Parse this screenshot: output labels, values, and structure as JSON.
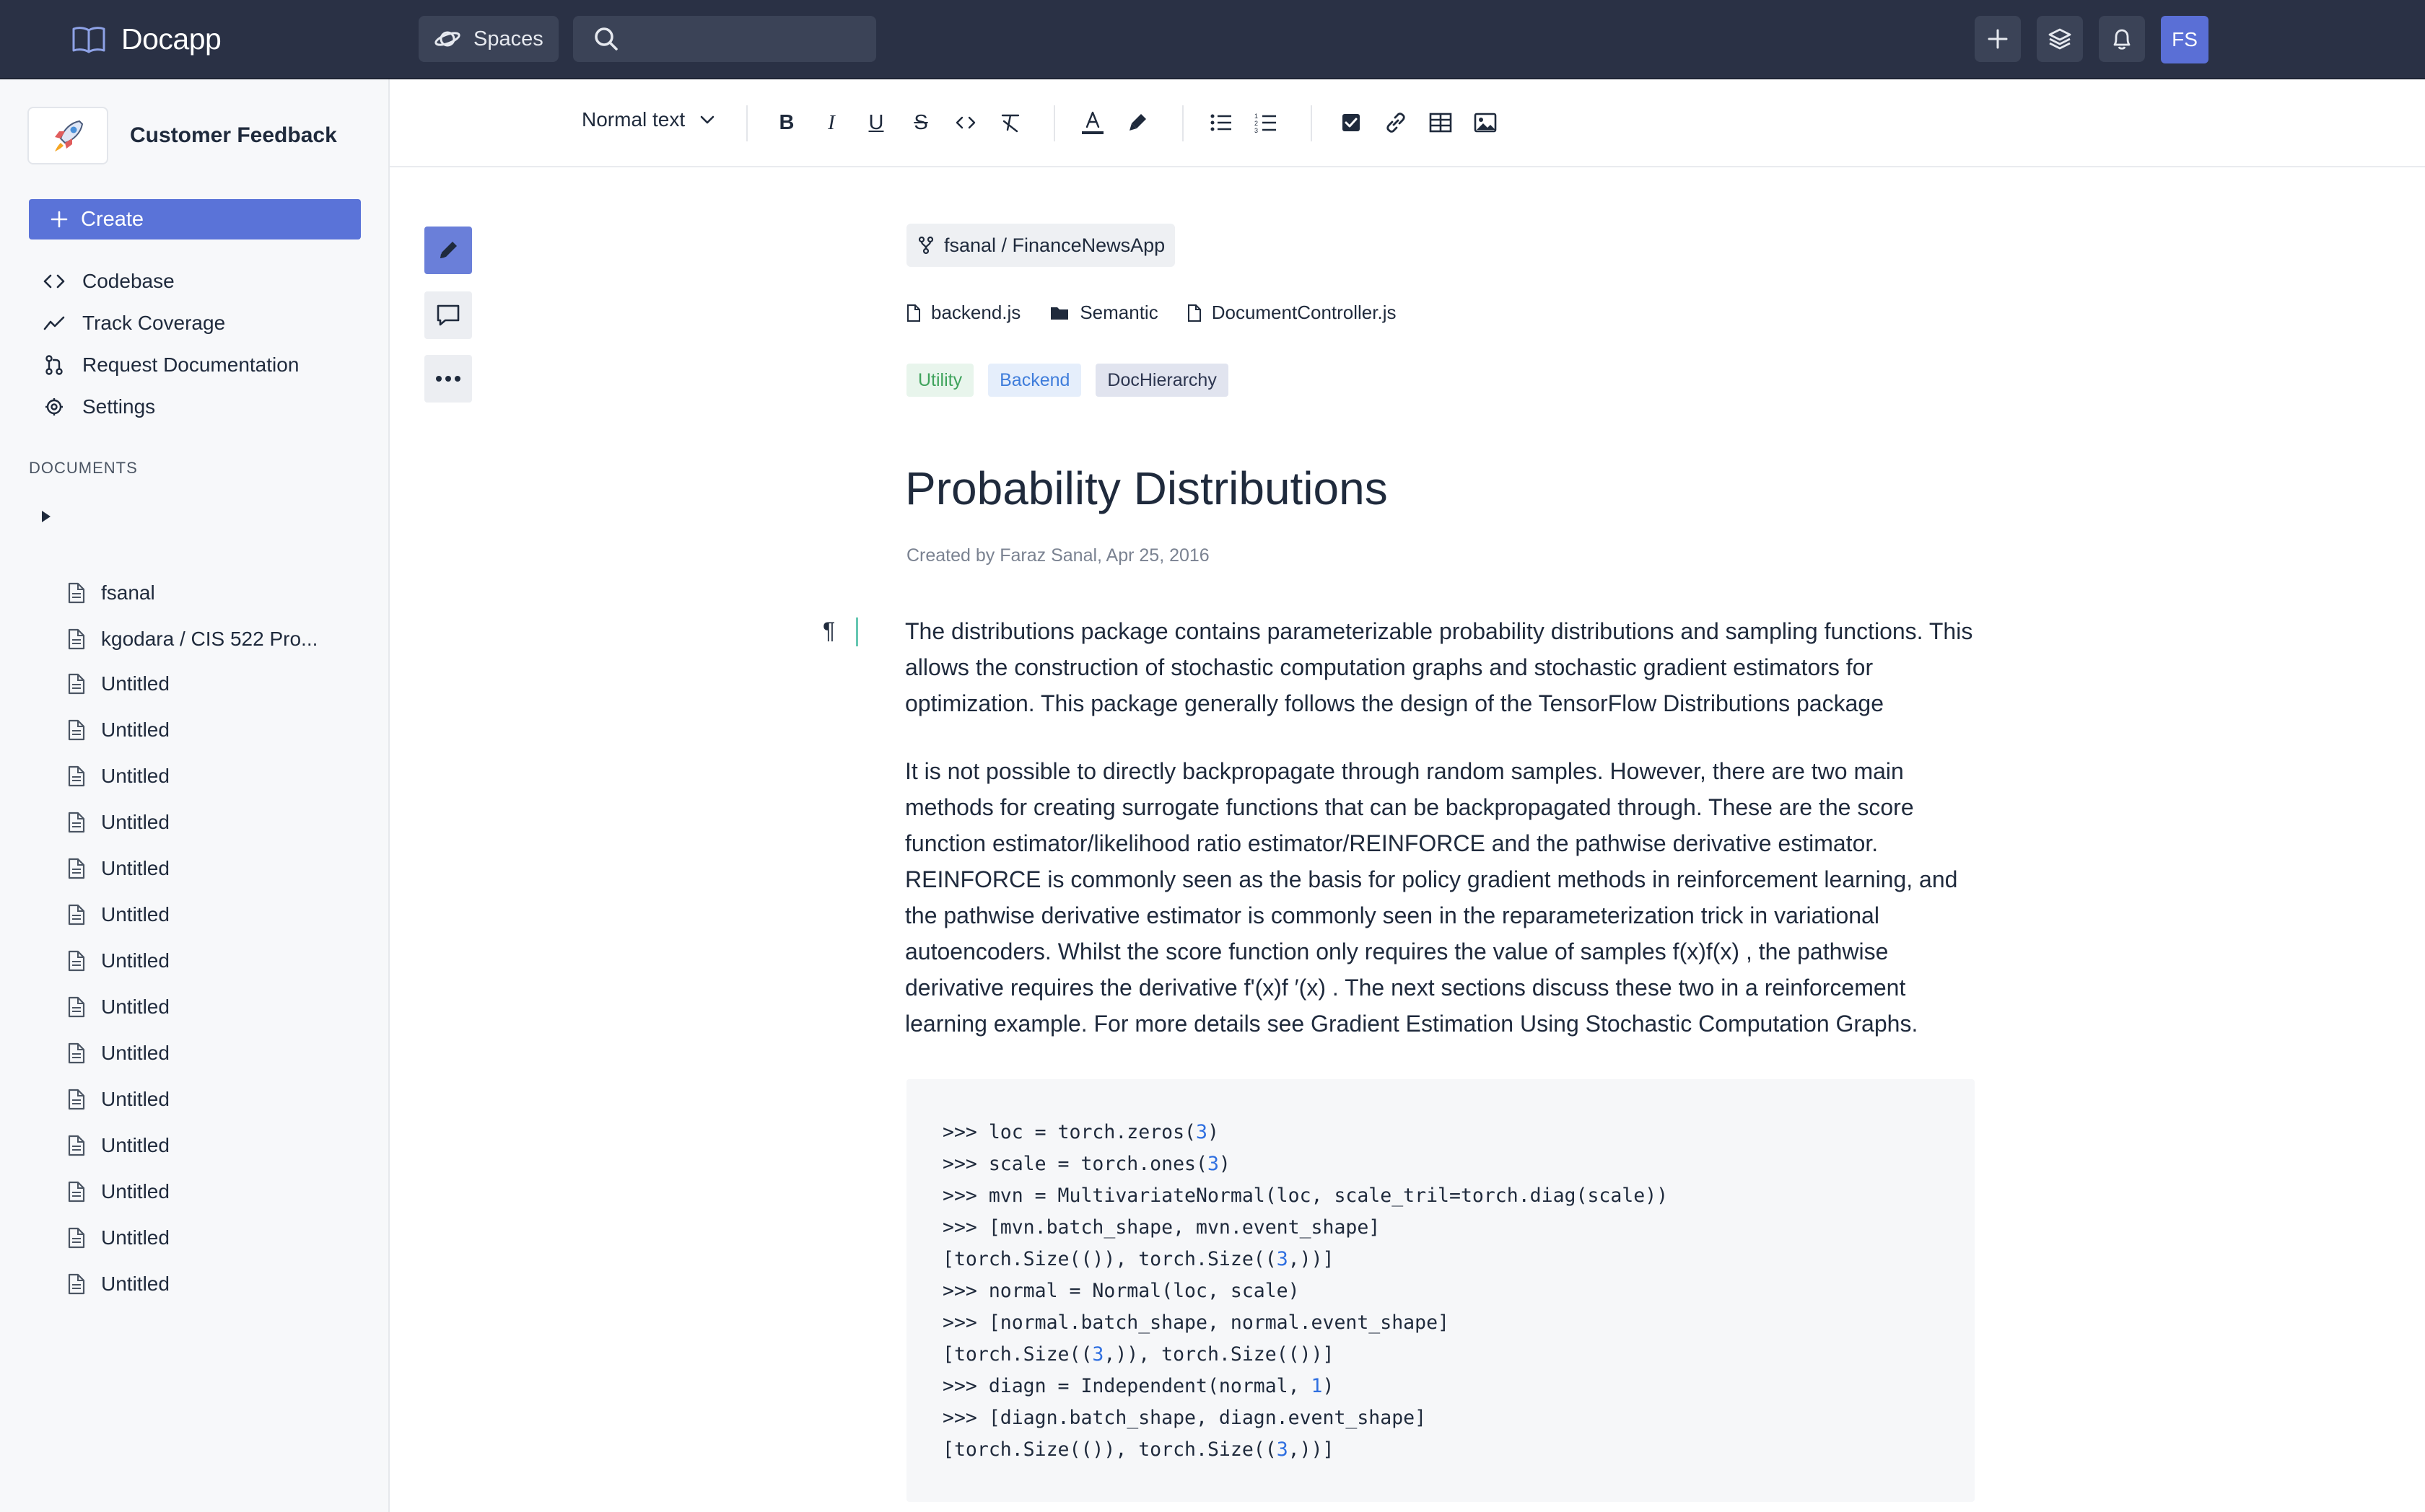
{
  "app": {
    "name": "Docapp"
  },
  "topbar": {
    "spaces_label": "Spaces",
    "search_placeholder": "",
    "avatar_initials": "FS",
    "icons": [
      "plus-icon",
      "layers-icon",
      "bell-icon"
    ]
  },
  "sidebar": {
    "space_title": "Customer Feedback",
    "create_label": "Create",
    "nav": [
      {
        "label": "Codebase",
        "icon": "code-icon"
      },
      {
        "label": "Track Coverage",
        "icon": "trend-icon"
      },
      {
        "label": "Request Documentation",
        "icon": "pull-request-icon"
      },
      {
        "label": "Settings",
        "icon": "gear-icon"
      }
    ],
    "documents_heading": "DOCUMENTS",
    "documents": [
      {
        "label": "fsanal",
        "expandable": true
      },
      {
        "label": "kgodara / CIS 522 Pro..."
      },
      {
        "label": "Untitled"
      },
      {
        "label": "Untitled"
      },
      {
        "label": "Untitled"
      },
      {
        "label": "Untitled"
      },
      {
        "label": "Untitled"
      },
      {
        "label": "Untitled"
      },
      {
        "label": "Untitled"
      },
      {
        "label": "Untitled"
      },
      {
        "label": "Untitled"
      },
      {
        "label": "Untitled"
      },
      {
        "label": "Untitled"
      },
      {
        "label": "Untitled"
      },
      {
        "label": "Untitled"
      },
      {
        "label": "Untitled"
      }
    ]
  },
  "toolbar": {
    "text_style": "Normal text",
    "buttons": [
      "bold",
      "italic",
      "underline",
      "strikethrough",
      "inline-code",
      "clear-format",
      "text-color",
      "highlight",
      "bullet-list",
      "numbered-list",
      "checkbox",
      "link",
      "table",
      "image"
    ]
  },
  "document": {
    "repo": "fsanal / FinanceNewsApp",
    "files": [
      {
        "label": "backend.js",
        "icon": "file-icon"
      },
      {
        "label": "Semantic",
        "icon": "folder-icon"
      },
      {
        "label": "DocumentController.js",
        "icon": "file-icon"
      }
    ],
    "tags": [
      {
        "label": "Utility",
        "color": "#3fa35c"
      },
      {
        "label": "Backend",
        "color": "#3f7ddb"
      },
      {
        "label": "DocHierarchy",
        "color": "#2d3650"
      }
    ],
    "title": "Probability Distributions",
    "meta": "Created by Faraz Sanal, Apr 25, 2016",
    "paragraph_marker": "¶",
    "paragraphs": [
      "The distributions package contains parameterizable probability distributions and sampling functions. This allows the construction of stochastic computation graphs and stochastic gradient estimators for optimization. This package generally follows the design of the TensorFlow Distributions package",
      "It is not possible to directly backpropagate through random samples. However, there are two main methods for creating surrogate functions that can be backpropagated through. These are the score function estimator/likelihood ratio estimator/REINFORCE and the pathwise derivative estimator. REINFORCE is commonly seen as the basis for policy gradient methods in reinforcement learning, and the pathwise derivative estimator is commonly seen in the reparameterization trick in variational autoencoders. Whilst the score function only requires the value of samples f(x)f(x) , the pathwise derivative requires the derivative f'(x)f ′(x) . The next sections discuss these two in a reinforcement learning example. For more details see Gradient Estimation Using Stochastic Computation Graphs."
    ],
    "code_lines": [
      ">>> loc = torch.zeros(3)",
      ">>> scale = torch.ones(3)",
      ">>> mvn = MultivariateNormal(loc, scale_tril=torch.diag(scale))",
      ">>> [mvn.batch_shape, mvn.event_shape]",
      "[torch.Size(()), torch.Size((3,))]",
      ">>> normal = Normal(loc, scale)",
      ">>> [normal.batch_shape, normal.event_shape]",
      "[torch.Size((3,)), torch.Size(())]",
      ">>> diagn = Independent(normal, 1)",
      ">>> [diagn.batch_shape, diagn.event_shape]",
      "[torch.Size(()), torch.Size((3,))]"
    ]
  },
  "colors": {
    "navbar": "#2a3145",
    "accent": "#5a73d8",
    "code_number": "#2f6fe0",
    "cursor": "#66c7b2"
  }
}
